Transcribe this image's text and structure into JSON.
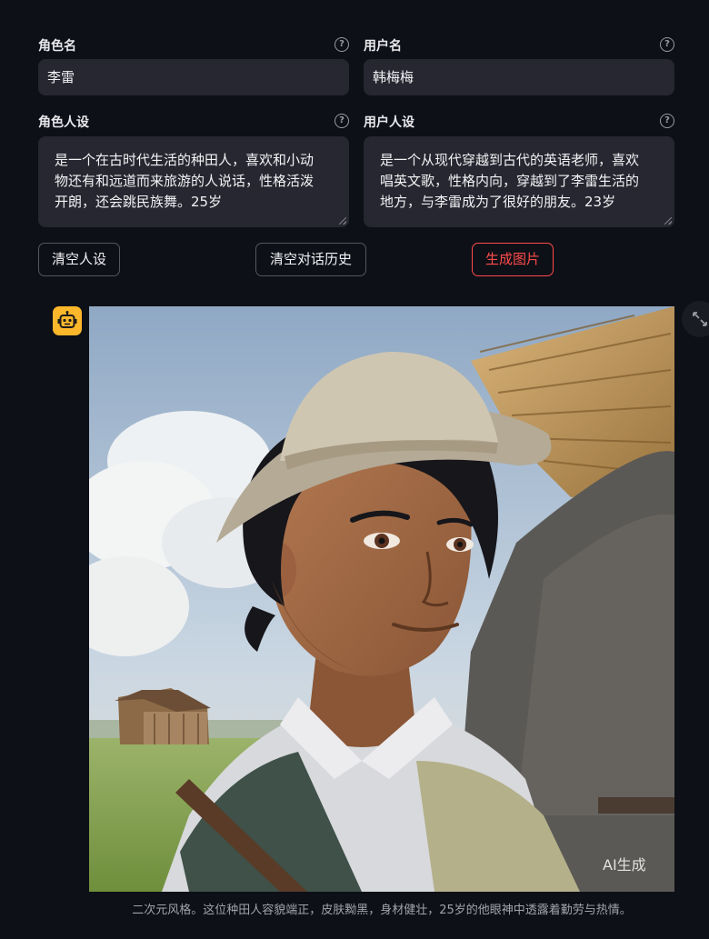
{
  "form": {
    "role_name": {
      "label": "角色名",
      "value": "李雷"
    },
    "user_name": {
      "label": "用户名",
      "value": "韩梅梅"
    },
    "role_persona": {
      "label": "角色人设",
      "lines": [
        "是一个在古时代生活的种田人，喜欢和小动",
        "物还有和远道而来旅游的人说话，性格活泼",
        "开朗，还会跳民族舞。25岁"
      ]
    },
    "user_persona": {
      "label": "用户人设",
      "lines": [
        "是一个从现代穿越到古代的英语老师，喜欢",
        "唱英文歌，性格内向，穿越到了李雷生活的",
        "地方，与李雷成为了很好的朋友。23岁"
      ]
    }
  },
  "buttons": {
    "clear_persona": "清空人设",
    "clear_history": "清空对话历史",
    "generate_image": "生成图片"
  },
  "chat": {
    "avatar_icon": "robot-icon",
    "image_tag": "AI生成",
    "caption": "二次元风格。这位种田人容貌端正，皮肤黝黑，身材健壮，25岁的他眼神中透露着勤劳与热情。"
  },
  "colors": {
    "background": "#0d1017",
    "input_bg": "#262730",
    "accent": "#ff4b4b",
    "avatar_bg": "#fdb72b"
  }
}
